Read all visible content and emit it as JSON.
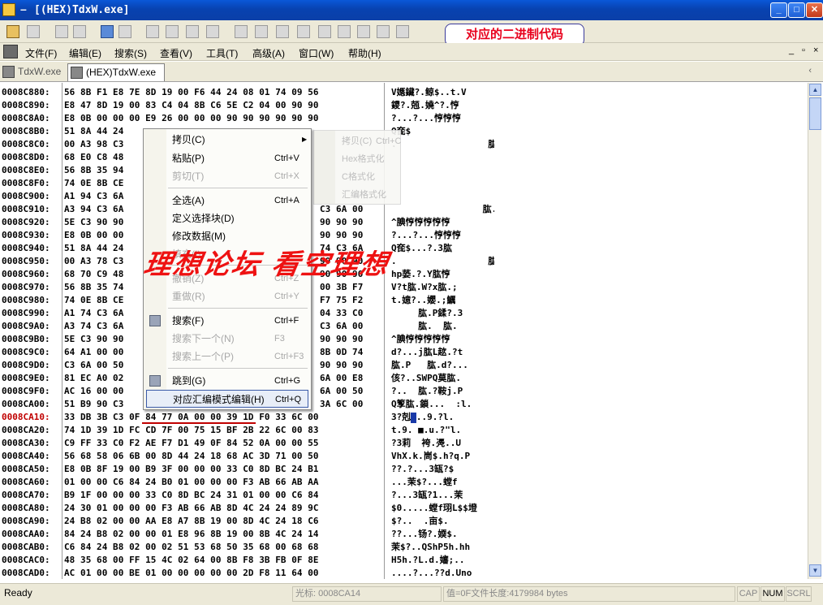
{
  "window": {
    "title_prefix": "–",
    "title": "[(HEX)TdxW.exe]",
    "min_label": "_",
    "max_label": "□",
    "close_label": "✕"
  },
  "annotation": "对应的二进制代码",
  "menubar": {
    "items": [
      "文件(F)",
      "编辑(E)",
      "搜索(S)",
      "查看(V)",
      "工具(T)",
      "高级(A)",
      "窗口(W)",
      "帮助(H)"
    ],
    "mdi_min": "_",
    "mdi_restore": "▫",
    "mdi_close": "×"
  },
  "tabs": [
    {
      "label": "TdxW.exe",
      "active": false
    },
    {
      "label": "(HEX)TdxW.exe",
      "active": true
    }
  ],
  "tab_scroll": "‹",
  "hex_rows": [
    {
      "addr": "0008C880:",
      "bytes": "56 8B F1 E8 7E 8D 19 00 F6 44 24 08 01 74 09 56",
      "ascii": "V嫕鑶?.鲸$..t.V"
    },
    {
      "addr": "0008C890:",
      "bytes": "E8 47 8D 19 00 83 C4 04 8B C6 5E C2 04 00 90 90",
      "ascii": "鑁?.兡.嬈^?.悙"
    },
    {
      "addr": "0008C8A0:",
      "bytes": "E8 0B 00 00 00 E9 26 00 00 00 90 90 90 90 90 90",
      "ascii": "?...?...悙悙悙"
    },
    {
      "addr": "0008C8B0:",
      "bytes": "51 8A 44 24",
      "ascii": "Q奃$"
    },
    {
      "addr": "0008C8C0:",
      "bytes": "00 A3 98 C3",
      "ascii": ".                 肱.Y腆悙"
    },
    {
      "addr": "0008C8D0:",
      "bytes": "68 E0 C8 48",
      "ascii": ""
    },
    {
      "addr": "0008C8E0:",
      "bytes": "56 8B 35 94",
      "ascii": ""
    },
    {
      "addr": "0008C8F0:",
      "bytes": "74 0E 8B CE",
      "ascii": ""
    },
    {
      "addr": "0008C900:",
      "bytes": "A1 94 C3 6A",
      "ascii": ""
    },
    {
      "addr": "0008C910:",
      "bytes": "A3 94 C3 6A",
      "rest": "C3 6A 00",
      "ascii": "                 肱.  肱."
    },
    {
      "addr": "0008C920:",
      "bytes": "5E C3 90 90",
      "rest": "90 90 90",
      "ascii": "^腆悙悙悙悙悙"
    },
    {
      "addr": "0008C930:",
      "bytes": "E8 0B 00 00",
      "rest": "90 90 90",
      "ascii": "?...?...悙悙悙"
    },
    {
      "addr": "0008C940:",
      "bytes": "51 8A 44 24",
      "rest": "74 C3 6A",
      "ascii": "Q奃$...?.3肱"
    },
    {
      "addr": "0008C950:",
      "bytes": "00 A3 78 C3",
      "rest": "90 90 90",
      "ascii": ".                 肱.Y腆悙"
    },
    {
      "addr": "0008C960:",
      "bytes": "68 70 C9 48",
      "rest": "90 90 90",
      "ascii": "hp蒆.?.Y肱悙"
    },
    {
      "addr": "0008C970:",
      "bytes": "56 8B 35 74",
      "rest": "00 3B F7",
      "ascii": "V?t肱.W?x肱.;"
    },
    {
      "addr": "0008C980:",
      "bytes": "74 0E 8B CE",
      "rest": "F7 75 F2",
      "ascii": "t.嬑?..孆.;鱱"
    },
    {
      "addr": "0008C990:",
      "bytes": "A1 74 C3 6A",
      "rest": "04 33 C0",
      "ascii": "     肱.P鍒?.3"
    },
    {
      "addr": "0008C9A0:",
      "bytes": "A3 74 C3 6A",
      "rest": "C3 6A 00",
      "ascii": "     肱.  肱."
    },
    {
      "addr": "0008C9B0:",
      "bytes": "5E C3 90 90",
      "rest": "90 90 90",
      "ascii": "^腆悙悙悙悙悙"
    },
    {
      "addr": "0008C9C0:",
      "bytes": "64 A1 00 00",
      "rest": "8B 0D 74",
      "ascii": "d?...j肱L趑.?t"
    },
    {
      "addr": "0008C9D0:",
      "bytes": "C3 6A 00 50",
      "rest": "90 90 90",
      "ascii": "肱.P   肱.d?..."
    },
    {
      "addr": "0008C9E0:",
      "bytes": "81 EC A0 02",
      "rest": "6A 00 E8",
      "ascii": "侅?..SWPQ莫肱."
    },
    {
      "addr": "0008C9F0:",
      "bytes": "AC 16 00 00",
      "rest": "6A 00 50",
      "ascii": "?..  肱.?鞍j.P"
    },
    {
      "addr": "0008CA00:",
      "bytes": "51 B9 90 C3",
      "rest": "3A 6C 00",
      "ascii": "Q箰肱.鎖...  :l."
    },
    {
      "addr": "0008CA10:",
      "bytes": "33 DB 3B C3 0F 84 77 0A 00 00 39 1D F0 33 6C 00",
      "ascii": "3?剋...9.?l.",
      "current": true
    },
    {
      "addr": "0008CA20:",
      "bytes": "74 1D 39 1D FC CD 7F 00 75 15 BF 2B 22 6C 00 83",
      "ascii": "t.9. ■.u.?\"l."
    },
    {
      "addr": "0008CA30:",
      "bytes": "C9 FF 33 C0 F2 AE F7 D1 49 0F 84 52 0A 00 00 55",
      "ascii": "?3莉  袴.凴..U"
    },
    {
      "addr": "0008CA40:",
      "bytes": "56 68 58 06 6B 00 8D 44 24 18 68 AC 3D 71 00 50",
      "ascii": "VhX.k.峝$.h?q.P"
    },
    {
      "addr": "0008CA50:",
      "bytes": "E8 0B 8F 19 00 B9 3F 00 00 00 33 C0 8D BC 24 B1",
      "ascii": "??.?...3缻?$"
    },
    {
      "addr": "0008CA60:",
      "bytes": "01 00 00 C6 84 24 B0 01 00 00 00 F3 AB 66 AB AA",
      "ascii": "...茉$?...螳f"
    },
    {
      "addr": "0008CA70:",
      "bytes": "B9 1F 00 00 00 33 C0 8D BC 24 31 01 00 00 C6 84",
      "ascii": "?...3缻?1...茉"
    },
    {
      "addr": "0008CA80:",
      "bytes": "24 30 01 00 00 00 F3 AB 66 AB 8D 4C 24 24 89 9C",
      "ascii": "$0.....螳f珝L$$墱"
    },
    {
      "addr": "0008CA90:",
      "bytes": "24 B8 02 00 00 AA E8 A7 8B 19 00 8D 4C 24 18 C6",
      "ascii": "$?..  .亩$."
    },
    {
      "addr": "0008CAA0:",
      "bytes": "84 24 B8 02 00 00 01 E8 96 8B 19 00 8B 4C 24 14",
      "ascii": "??...钖?.媆$."
    },
    {
      "addr": "0008CAB0:",
      "bytes": "C6 84 24 B8 02 00 02 51 53 68 50 35 68 00 68 68",
      "ascii": "茉$?..QShP5h.hh"
    },
    {
      "addr": "0008CAC0:",
      "bytes": "48 35 68 00 FF 15 4C 02 64 00 8B F8 3B FB 0F 8E",
      "ascii": "H5h.?L.d.嬸;.."
    },
    {
      "addr": "0008CAD0:",
      "bytes": "AC 01 00 00 BE 01 00 00 00 00 00 2D F8 11 64 00",
      "ascii": "....?...??d.Uno"
    }
  ],
  "context_menu": {
    "items": [
      {
        "label": "拷贝(C)",
        "shortcut": "",
        "submenu": true,
        "disabled": false
      },
      {
        "label": "粘贴(P)",
        "shortcut": "Ctrl+V",
        "disabled": false
      },
      {
        "label": "剪切(T)",
        "shortcut": "Ctrl+X",
        "disabled": true
      },
      {
        "label": "全选(A)",
        "shortcut": "Ctrl+A",
        "disabled": false
      },
      {
        "label": "定义选择块(D)",
        "shortcut": "",
        "disabled": false
      },
      {
        "label": "修改数据(M)",
        "shortcut": "",
        "disabled": false
      },
      {
        "label": "填充(I)",
        "shortcut": "",
        "disabled": true
      },
      {
        "label": "撤销(Z)",
        "shortcut": "Ctrl+Z",
        "disabled": true
      },
      {
        "label": "重做(R)",
        "shortcut": "Ctrl+Y",
        "disabled": true
      },
      {
        "label": "搜索(F)",
        "shortcut": "Ctrl+F",
        "disabled": false
      },
      {
        "label": "搜索下一个(N)",
        "shortcut": "F3",
        "disabled": true
      },
      {
        "label": "搜索上一个(P)",
        "shortcut": "Ctrl+F3",
        "disabled": true
      },
      {
        "label": "跳到(G)",
        "shortcut": "Ctrl+G",
        "disabled": false
      },
      {
        "label": "对应汇编模式编辑(H)",
        "shortcut": "Ctrl+Q",
        "disabled": false,
        "highlighted": true
      }
    ]
  },
  "submenu": {
    "items": [
      {
        "label": "拷贝(C)",
        "shortcut": "Ctrl+C"
      },
      {
        "label": "Hex格式化",
        "shortcut": ""
      },
      {
        "label": "C格式化",
        "shortcut": ""
      },
      {
        "label": "汇编格式化",
        "shortcut": ""
      }
    ]
  },
  "watermark": "理想论坛 看空理想",
  "statusbar": {
    "ready": "Ready",
    "cursor": "光标: 0008CA14",
    "value": "值=0F文件长度:4179984 bytes",
    "cap": "CAP",
    "num": "NUM",
    "scrl": "SCRL"
  },
  "colors": {
    "titlebar": "#0a4fcf",
    "current_addr": "#c00000",
    "watermark": "#ee1212",
    "annotation": "#e8001c"
  }
}
